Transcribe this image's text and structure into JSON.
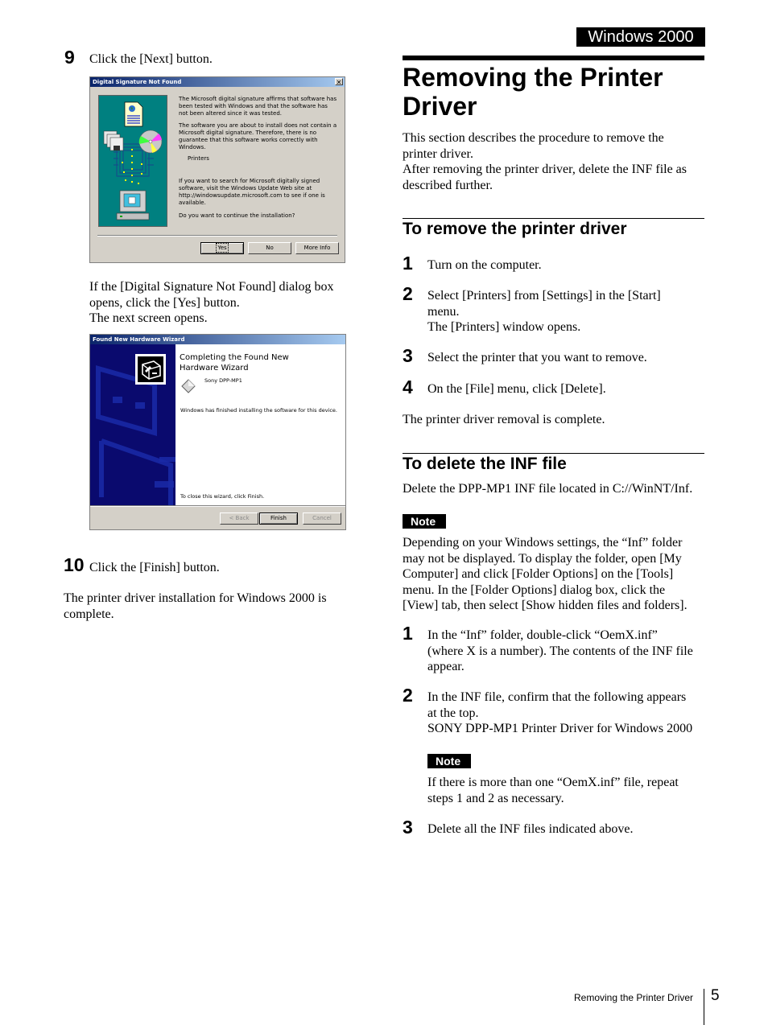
{
  "header": {
    "section_tab": "Windows 2000"
  },
  "left": {
    "step9": {
      "number": "9",
      "text": "Click the [Next] button."
    },
    "dialog1": {
      "title": "Digital Signature Not Found",
      "close_glyph": "✕",
      "paragraphs": [
        "The Microsoft digital signature affirms that software has been tested with Windows and that the software has not been altered since it was tested.",
        "The software you are about to install does not contain a Microsoft digital signature. Therefore, there is no guarantee that this software works correctly with Windows.",
        "Printers",
        "If you want to search for Microsoft digitally signed software, visit the Windows Update Web site at http://windowsupdate.microsoft.com to see if one is available.",
        "Do you want to continue the installation?"
      ],
      "buttons": {
        "yes": "Yes",
        "no": "No",
        "more_info": "More Info"
      }
    },
    "note_after_dialog1": [
      "If the [Digital Signature Not Found] dialog box",
      "opens, click the [Yes] button.",
      "The next screen opens."
    ],
    "dialog2": {
      "title": "Found New Hardware Wizard",
      "heading": "Completing the Found New Hardware Wizard",
      "device": "Sony DPP-MP1",
      "status": "Windows has finished installing the software for this device.",
      "close_hint": "To close this wizard, click Finish.",
      "buttons": {
        "back": "< Back",
        "finish": "Finish",
        "cancel": "Cancel"
      }
    },
    "step10": {
      "number": "10",
      "text": "Click the [Finish] button."
    },
    "completion": "The printer driver installation for Windows 2000 is complete."
  },
  "right": {
    "title_line1": "Removing the Printer",
    "title_line2": "Driver",
    "intro": [
      "This section describes the procedure to remove the",
      "printer driver.",
      "After removing the printer driver, delete the INF file as",
      "described further."
    ],
    "remove_section": {
      "heading": "To remove the printer driver",
      "steps": [
        {
          "number": "1",
          "lines": [
            "Turn on the computer."
          ]
        },
        {
          "number": "2",
          "lines": [
            "Select [Printers] from [Settings] in the [Start]",
            "menu.",
            "The [Printers] window opens."
          ]
        },
        {
          "number": "3",
          "lines": [
            "Select the printer that you want to remove."
          ]
        },
        {
          "number": "4",
          "lines": [
            "On the [File] menu, click [Delete]."
          ]
        }
      ],
      "result": "The printer driver removal is complete."
    },
    "inf_section": {
      "heading": "To delete the INF file",
      "intro": "Delete the DPP-MP1 INF file located in C://WinNT/Inf.",
      "note_label": "Note",
      "note_lines": [
        "Depending on your Windows settings, the “Inf” folder",
        "may not be displayed. To display the folder, open [My",
        "Computer] and click [Folder Options] on the [Tools]",
        "menu. In the [Folder Options] dialog box, click the",
        "[View] tab, then select [Show hidden files and folders]."
      ],
      "steps": [
        {
          "number": "1",
          "lines": [
            "In the “Inf” folder, double-click “OemX.inf”",
            "(where X is a number). The contents of the INF file",
            "appear."
          ]
        },
        {
          "number": "2",
          "lines": [
            "In the INF file, confirm that the following appears",
            "at the top.",
            "SONY DPP-MP1 Printer Driver for Windows 2000"
          ]
        },
        {
          "number": "3",
          "lines": [
            "Delete all the INF files indicated above."
          ]
        }
      ],
      "step_note_label": "Note",
      "step_note_lines": [
        "If there is more than one “OemX.inf” file, repeat",
        "steps 1 and 2 as necessary."
      ]
    }
  },
  "footer": {
    "running_title": "Removing the Printer Driver",
    "page_number": "5"
  }
}
